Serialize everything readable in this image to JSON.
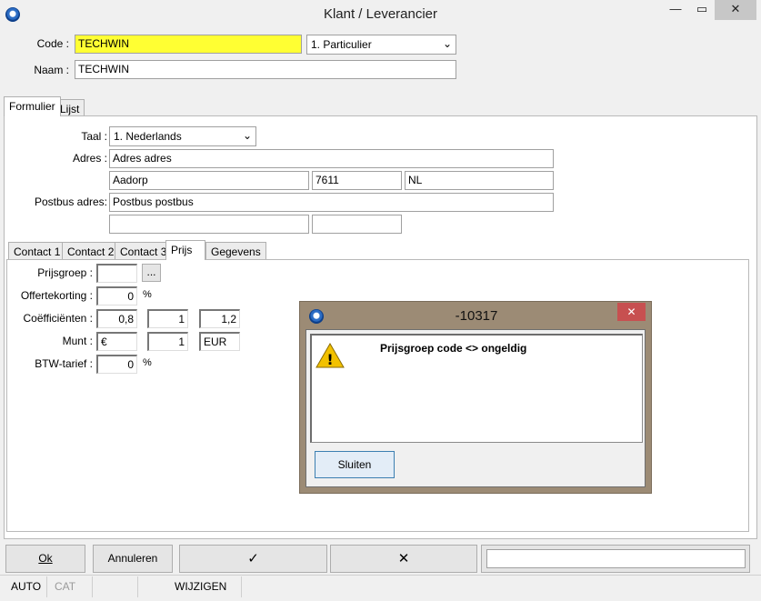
{
  "window": {
    "title": "Klant / Leverancier",
    "minimize": "—",
    "maximize": "▭",
    "close": "✕"
  },
  "header": {
    "code_label": "Code :",
    "code_value": "TECHWIN",
    "type_value": "1.  Particulier",
    "naam_label": "Naam :",
    "naam_value": "TECHWIN"
  },
  "main_tabs": [
    {
      "label": "Formulier"
    },
    {
      "label": "Lijst"
    }
  ],
  "form": {
    "taal_label": "Taal :",
    "taal_value": "1.  Nederlands",
    "adres_label": "Adres :",
    "adres_value": "Adres adres",
    "plaats_value": "Aadorp",
    "postcode_value": "7611",
    "land_value": "NL",
    "postbus_label": "Postbus adres:",
    "postbus_value": "Postbus postbus",
    "postbus_plaats": "",
    "postbus_postcode": ""
  },
  "sub_tabs": [
    {
      "label": "Contact 1"
    },
    {
      "label": "Contact 2"
    },
    {
      "label": "Contact 3"
    },
    {
      "label": "Prijs"
    },
    {
      "label": "Gegevens"
    }
  ],
  "prijs": {
    "prijsgroep_label": "Prijsgroep :",
    "prijsgroep_value": "",
    "browse_label": "...",
    "offertekorting_label": "Offertekorting :",
    "offertekorting_value": "0",
    "percent": "%",
    "coef_label": "Coëfficiënten :",
    "coef1": "0,8",
    "coef2": "1",
    "coef3": "1,2",
    "munt_label": "Munt :",
    "munt_symbol": "€",
    "munt_rate": "1",
    "munt_code": "EUR",
    "btw_label": "BTW-tarief :",
    "btw_value": "0"
  },
  "dialog": {
    "title": "-10317",
    "close": "✕",
    "message": "Prijsgroep code <> ongeldig",
    "button": "Sluiten",
    "warning_glyph": "!"
  },
  "buttons": {
    "ok": "Ok",
    "annuleren": "Annuleren",
    "confirm": "✓",
    "cancel": "✕",
    "field": ""
  },
  "statusbar": {
    "auto": "AUTO",
    "cat": "CAT",
    "mode": "WIJZIGEN"
  },
  "colors": {
    "code_bg": "#ffff33",
    "dialog_frame": "#9c8b75",
    "close_red": "#c75050",
    "warning": "#f2c100"
  }
}
